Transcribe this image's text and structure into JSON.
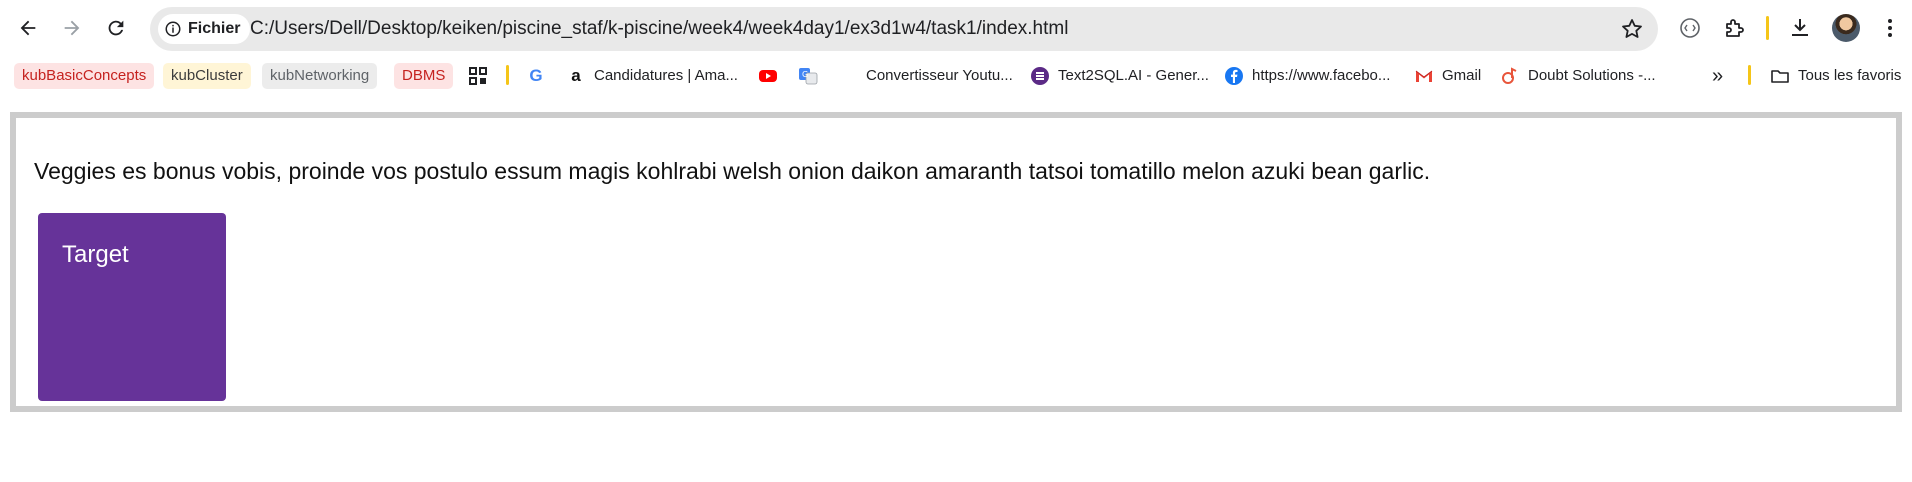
{
  "browser": {
    "site_chip": "Fichier",
    "url": "C:/Users/Dell/Desktop/keiken/piscine_staf/k-piscine/week4/week4day1/ex3d1w4/task1/index.html",
    "icons": [
      "back-icon",
      "forward-icon",
      "reload-icon",
      "info-icon",
      "star-icon",
      "lens-icon",
      "extensions-icon",
      "download-icon",
      "avatar",
      "menu-icon"
    ]
  },
  "bookmarks": {
    "items": [
      {
        "label": "kubBasicConcepts",
        "bg": "#fde3e3",
        "color": "#c5221f"
      },
      {
        "label": "kubCluster",
        "bg": "#fff5d6",
        "color": "#3c3c3c"
      },
      {
        "label": "kubNetworking",
        "bg": "#ececec",
        "color": "#5f6368"
      },
      {
        "label": "DBMS",
        "bg": "#fde3e3",
        "color": "#c5221f"
      },
      {
        "label": "Candidatures | Ama..."
      },
      {
        "label": "Convertisseur Youtu..."
      },
      {
        "label": "Text2SQL.AI - Gener..."
      },
      {
        "label": "https://www.facebo..."
      },
      {
        "label": "Gmail"
      },
      {
        "label": "Doubt Solutions -..."
      },
      {
        "label": "Tous les favoris"
      }
    ],
    "overflow": "»"
  },
  "page": {
    "paragraph": "Veggies es bonus vobis, proinde vos postulo essum magis kohlrabi welsh onion daikon amaranth tatsoi tomatillo melon azuki bean garlic.",
    "target_label": "Target",
    "target_color": "#663399",
    "frame_border_color": "#cccccc"
  }
}
